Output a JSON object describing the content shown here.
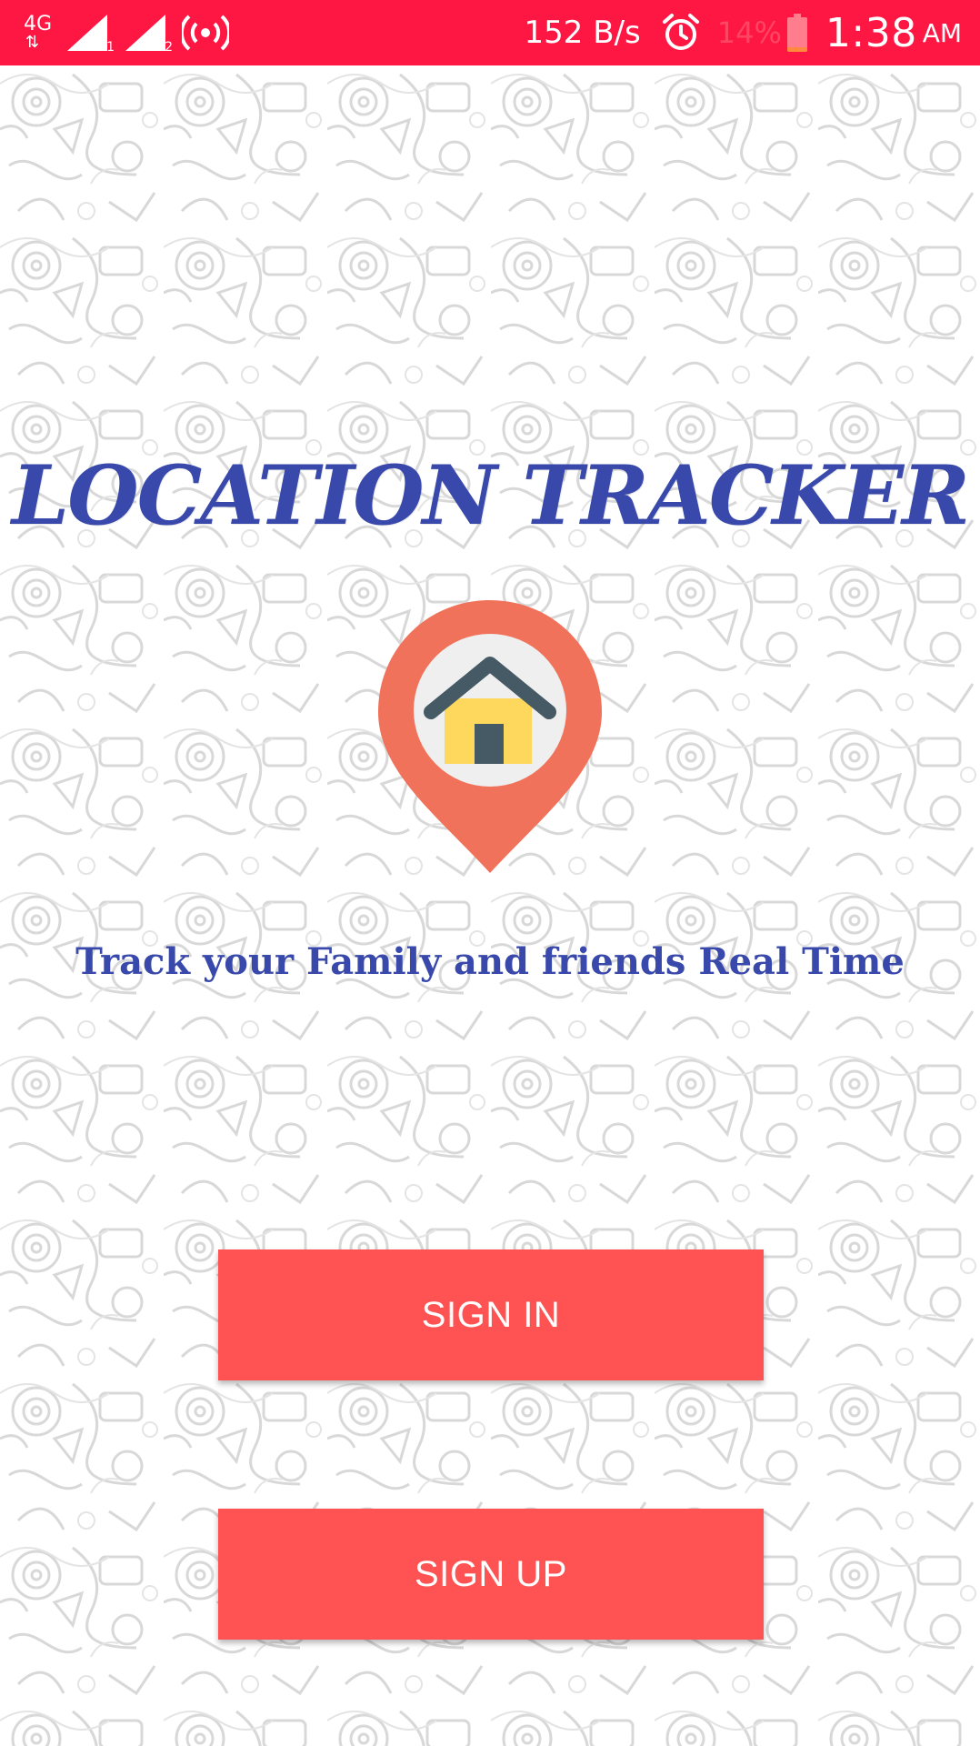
{
  "status_bar": {
    "network_type": "4G",
    "sim1_label": "1",
    "sim2_label": "2",
    "net_speed": "152 B/s",
    "battery_percent": "14%",
    "battery_level": 0.14,
    "time": "1:38",
    "ampm": "AM",
    "icons": [
      "data-arrows-icon",
      "signal-icon",
      "signal-icon",
      "hotspot-icon",
      "alarm-icon",
      "battery-icon"
    ]
  },
  "app": {
    "title": "LOCATION TRACKER",
    "tagline": "Track your Family and friends Real Time",
    "logo_icon": "home-location-pin-icon"
  },
  "buttons": {
    "sign_in": "SIGN IN",
    "sign_up": "SIGN UP"
  },
  "colors": {
    "status_bar": "#ff1744",
    "title_text": "#3949ab",
    "button_bg": "#ff5252",
    "pin": "#f1725a",
    "house_roof": "#455a64",
    "house_wall": "#fdd85d"
  }
}
